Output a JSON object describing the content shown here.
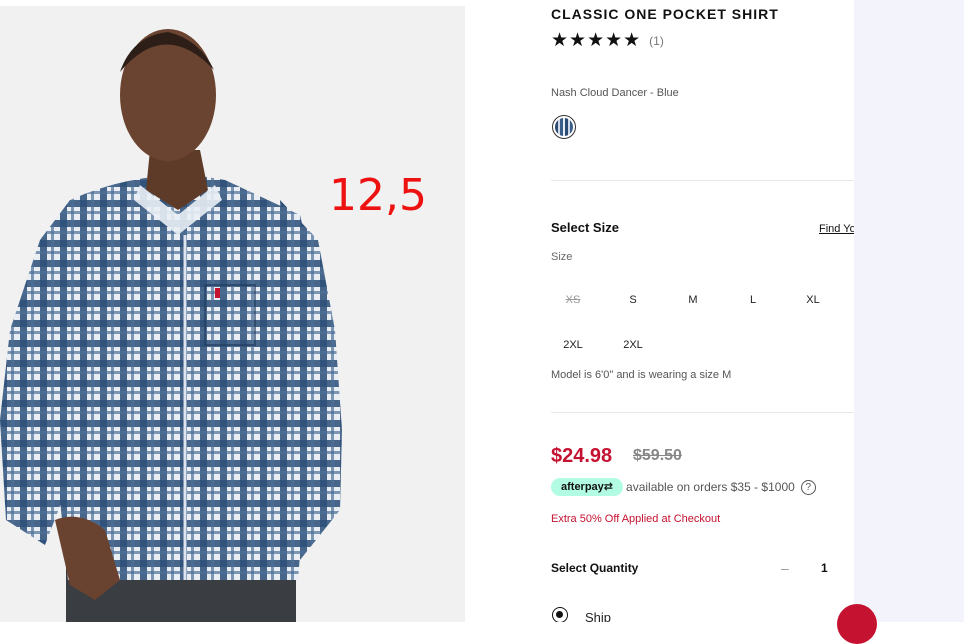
{
  "annotation": {
    "text": "12,5"
  },
  "product": {
    "title": "CLASSIC ONE POCKET SHIRT",
    "stars": "★★★★★",
    "review_count": "(1)",
    "color_name": "Nash Cloud Dancer - Blue"
  },
  "sizes": {
    "heading": "Select Size",
    "find_link": "Find Yo",
    "label": "Size",
    "options": [
      {
        "label": "XS",
        "available": false
      },
      {
        "label": "S",
        "available": true
      },
      {
        "label": "M",
        "available": true
      },
      {
        "label": "L",
        "available": true
      },
      {
        "label": "XL",
        "available": true
      },
      {
        "label": "2XL",
        "available": true
      },
      {
        "label": "2XL",
        "available": true
      }
    ],
    "model_note": "Model is 6'0\" and is wearing a size M"
  },
  "pricing": {
    "sale_price": "$24.98",
    "original_price": "$59.50",
    "afterpay_badge": "afterpay⇄",
    "afterpay_text": "available on orders $35 - $1000",
    "help_icon": "?",
    "promo": "Extra 50% Off Applied at Checkout"
  },
  "quantity": {
    "label": "Select Quantity",
    "minus": "–",
    "value": "1"
  },
  "fulfillment": {
    "ship_label": "Ship"
  },
  "colors": {
    "accent": "#c41230",
    "afterpay": "#b2fce4"
  }
}
